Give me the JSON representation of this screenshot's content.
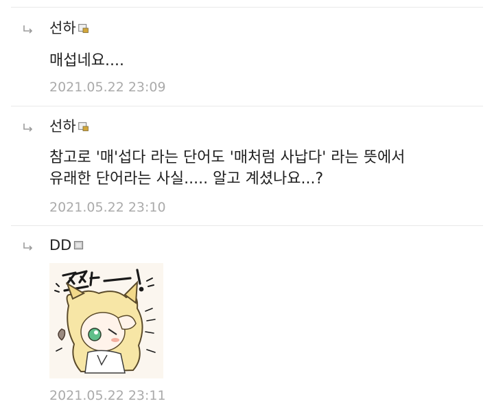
{
  "comments": [
    {
      "author": "선하",
      "text": "매섭네요....",
      "time": "2021.05.22 23:09"
    },
    {
      "author": "선하",
      "text": "참고로 '매'섭다 라는 단어도 '매처럼 사납다' 라는 뜻에서\n유래한 단어라는 사실..... 알고 계셨나요...?",
      "time": "2021.05.22 23:10"
    },
    {
      "author": "DD",
      "sticker_text": "쯔악—!",
      "time": "2021.05.22 23:11"
    }
  ],
  "colors": {
    "author": "#222222",
    "time": "#aaaaaa",
    "divider": "#e8e8e8",
    "badge_gold": "#d2a63a"
  },
  "icons": {
    "reply": "reply-arrow-icon",
    "member_badge": "member-badge-icon",
    "guest_badge": "guest-badge-icon"
  }
}
